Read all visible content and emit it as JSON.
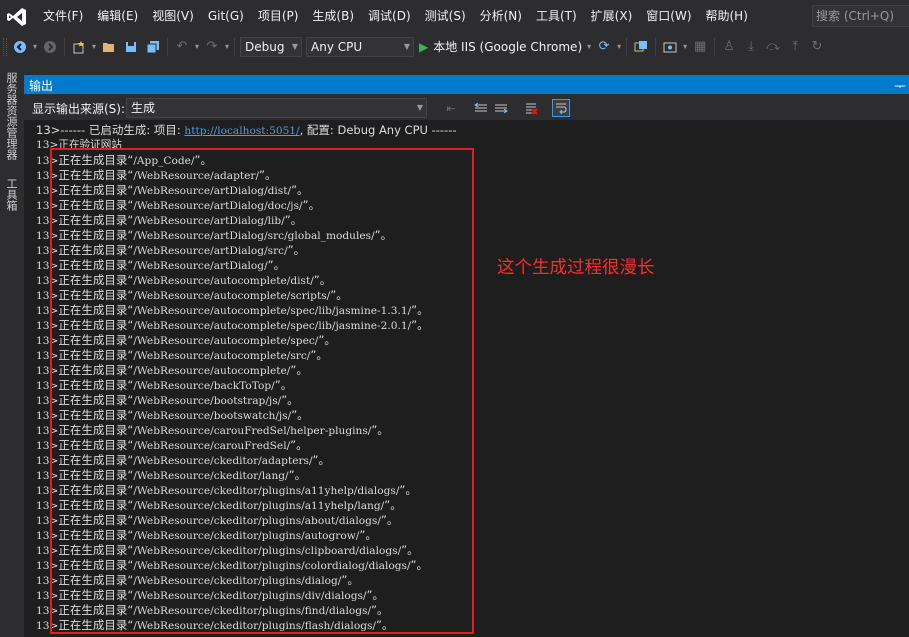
{
  "menu": {
    "items": [
      "文件(F)",
      "编辑(E)",
      "视图(V)",
      "Git(G)",
      "项目(P)",
      "生成(B)",
      "调试(D)",
      "测试(S)",
      "分析(N)",
      "工具(T)",
      "扩展(X)",
      "窗口(W)",
      "帮助(H)"
    ],
    "search_placeholder": "搜索 (Ctrl+Q)"
  },
  "toolbar": {
    "configuration": "Debug",
    "platform": "Any CPU",
    "run_target": "本地 IIS (Google Chrome)"
  },
  "left_strip": {
    "tabs": [
      "服务器资源管理器",
      "工具箱"
    ]
  },
  "output": {
    "title": "输出",
    "source_label": "显示输出来源(S):",
    "source_value": "生成",
    "header_prefix": "13>------ 已启动生成: 项目: ",
    "header_link": "http://localhost:5051/",
    "header_suffix": ", 配置: Debug Any CPU ------",
    "verify_line": "13>正在验证网站",
    "line_prefix": "13>",
    "line_label": "正在生成目录",
    "directories": [
      "/App_Code/",
      "/WebResource/adapter/",
      "/WebResource/artDialog/dist/",
      "/WebResource/artDialog/doc/js/",
      "/WebResource/artDialog/lib/",
      "/WebResource/artDialog/src/global_modules/",
      "/WebResource/artDialog/src/",
      "/WebResource/artDialog/",
      "/WebResource/autocomplete/dist/",
      "/WebResource/autocomplete/scripts/",
      "/WebResource/autocomplete/spec/lib/jasmine-1.3.1/",
      "/WebResource/autocomplete/spec/lib/jasmine-2.0.1/",
      "/WebResource/autocomplete/spec/",
      "/WebResource/autocomplete/src/",
      "/WebResource/autocomplete/",
      "/WebResource/backToTop/",
      "/WebResource/bootstrap/js/",
      "/WebResource/bootswatch/js/",
      "/WebResource/carouFredSel/helper-plugins/",
      "/WebResource/carouFredSel/",
      "/WebResource/ckeditor/adapters/",
      "/WebResource/ckeditor/lang/",
      "/WebResource/ckeditor/plugins/a11yhelp/dialogs/",
      "/WebResource/ckeditor/plugins/a11yhelp/lang/",
      "/WebResource/ckeditor/plugins/about/dialogs/",
      "/WebResource/ckeditor/plugins/autogrow/",
      "/WebResource/ckeditor/plugins/clipboard/dialogs/",
      "/WebResource/ckeditor/plugins/colordialog/dialogs/",
      "/WebResource/ckeditor/plugins/dialog/",
      "/WebResource/ckeditor/plugins/div/dialogs/",
      "/WebResource/ckeditor/plugins/find/dialogs/",
      "/WebResource/ckeditor/plugins/flash/dialogs/"
    ]
  },
  "annotation": {
    "text": "这个生成过程很漫长",
    "color": "#ff2a2a"
  },
  "colors": {
    "accent": "#007acc",
    "background": "#1e1e1e",
    "chrome": "#2d2d30",
    "run_green": "#3fb34f",
    "link": "#569cd6"
  }
}
